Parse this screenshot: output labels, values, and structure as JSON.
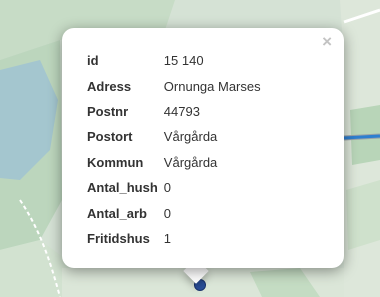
{
  "popup": {
    "close_label": "×",
    "rows": [
      {
        "key": "id",
        "value": "15 140"
      },
      {
        "key": "Adress",
        "value": "Ornunga Marses"
      },
      {
        "key": "Postnr",
        "value": "44793"
      },
      {
        "key": "Postort",
        "value": "Vårgårda"
      },
      {
        "key": "Kommun",
        "value": "Vårgårda"
      },
      {
        "key": "Antal_hush",
        "value": "0"
      },
      {
        "key": "Antal_arb",
        "value": "0"
      },
      {
        "key": "Fritidshus",
        "value": "1"
      }
    ]
  },
  "map": {
    "colors": {
      "land": "#e9ece5",
      "forest": "#c5dcc4",
      "water": "#a3c4cd",
      "road": "#2d7fd0",
      "road_casing": "#9aa3a8",
      "marker": "#2a4f9a"
    },
    "marker_icon": "location-dot-icon"
  }
}
